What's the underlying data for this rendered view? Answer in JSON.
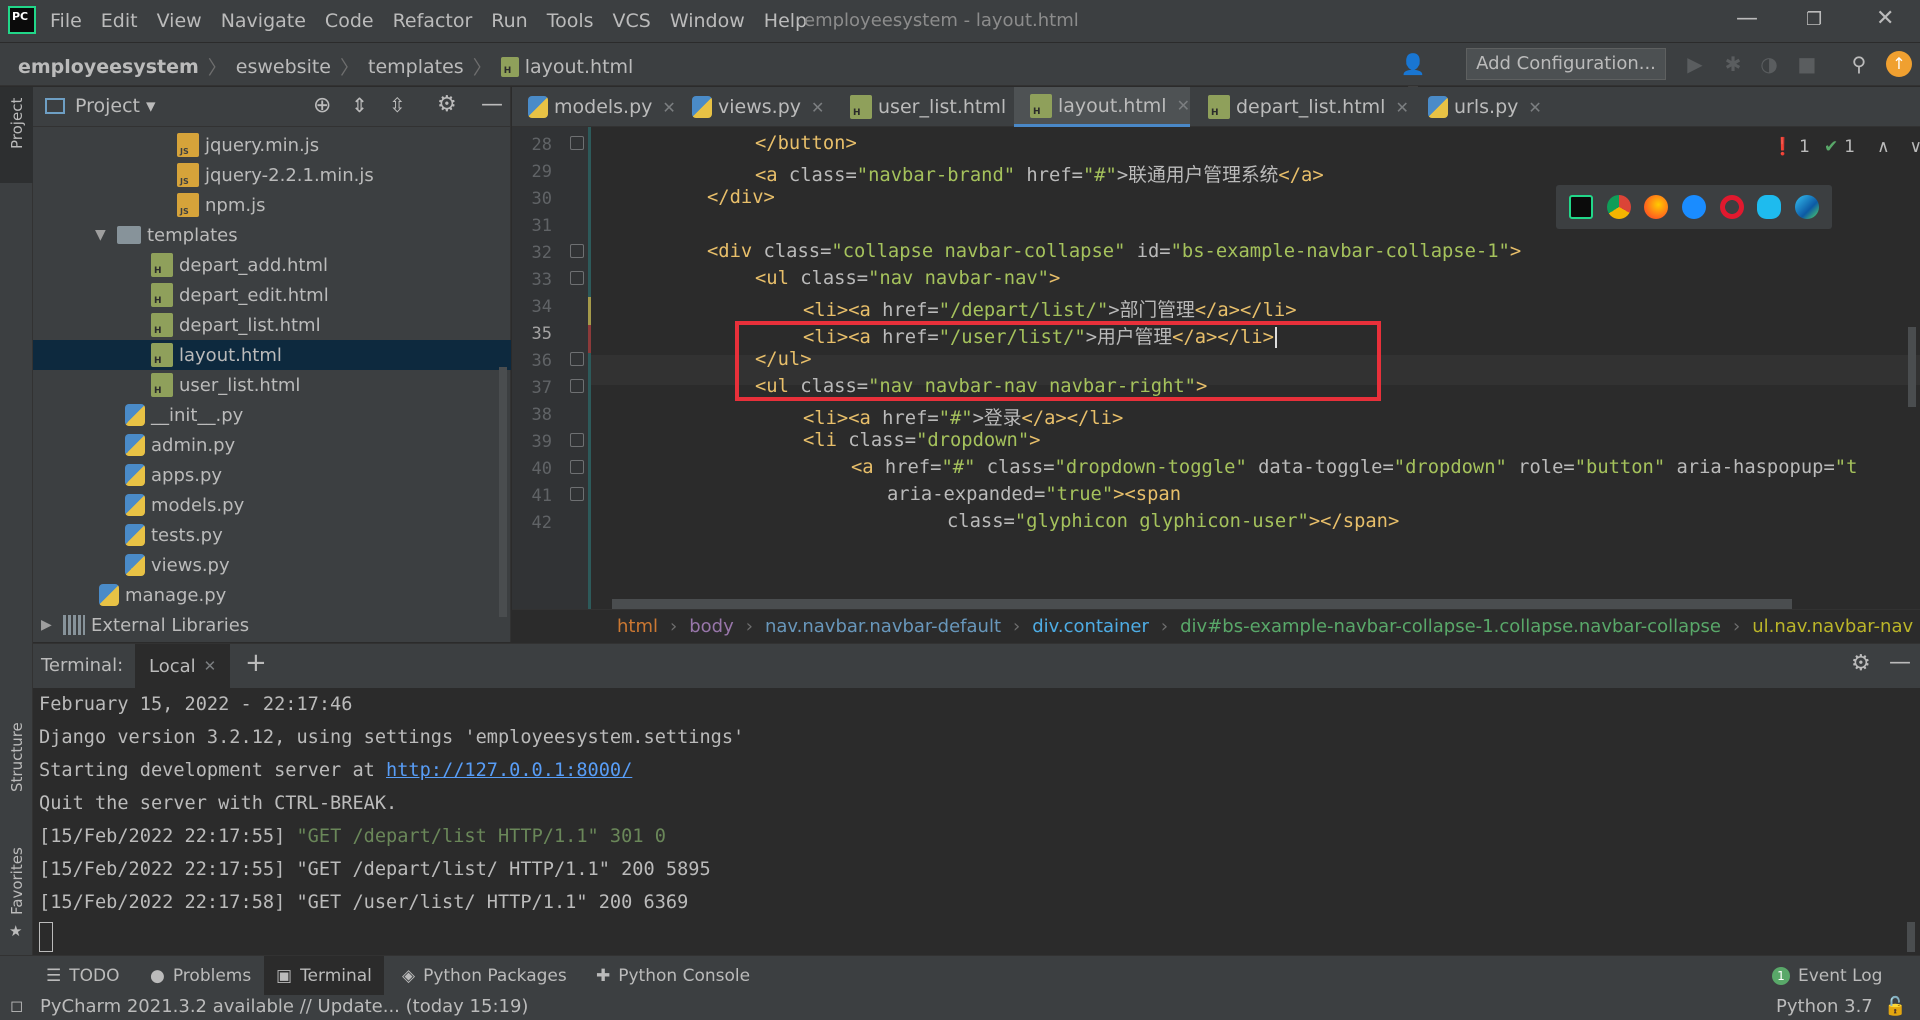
{
  "app": {
    "title": "employeesystem - layout.html",
    "logo": "PC",
    "menu": [
      "File",
      "Edit",
      "View",
      "Navigate",
      "Code",
      "Refactor",
      "Run",
      "Tools",
      "VCS",
      "Window",
      "Help"
    ]
  },
  "breadcrumb": {
    "project": "employeesystem",
    "items": [
      "eswebsite",
      "templates",
      "layout.html"
    ]
  },
  "toolbar": {
    "add_config": "Add Configuration..."
  },
  "side_labels": {
    "project": "Project",
    "structure": "Structure",
    "favorites": "Favorites"
  },
  "project_panel": {
    "title": "Project",
    "tree": [
      {
        "label": "jquery.min.js",
        "icon": "js-file-icon"
      },
      {
        "label": "jquery-2.2.1.min.js",
        "icon": "js-file-icon"
      },
      {
        "label": "npm.js",
        "icon": "js-file-icon"
      },
      {
        "label": "templates",
        "icon": "folder-icon"
      },
      {
        "label": "depart_add.html",
        "icon": "html-file-icon"
      },
      {
        "label": "depart_edit.html",
        "icon": "html-file-icon"
      },
      {
        "label": "depart_list.html",
        "icon": "html-file-icon"
      },
      {
        "label": "layout.html",
        "icon": "html-file-icon"
      },
      {
        "label": "user_list.html",
        "icon": "html-file-icon"
      },
      {
        "label": "__init__.py",
        "icon": "python-file-icon"
      },
      {
        "label": "admin.py",
        "icon": "python-file-icon"
      },
      {
        "label": "apps.py",
        "icon": "python-file-icon"
      },
      {
        "label": "models.py",
        "icon": "python-file-icon"
      },
      {
        "label": "tests.py",
        "icon": "python-file-icon"
      },
      {
        "label": "views.py",
        "icon": "python-file-icon"
      },
      {
        "label": "manage.py",
        "icon": "python-file-icon"
      },
      {
        "label": "External Libraries",
        "icon": "library-icon"
      }
    ]
  },
  "tabs": [
    "models.py",
    "views.py",
    "user_list.html",
    "layout.html",
    "depart_list.html",
    "urls.py"
  ],
  "editor": {
    "line_numbers": [
      "28",
      "29",
      "30",
      "31",
      "32",
      "33",
      "34",
      "35",
      "36",
      "37",
      "38",
      "39",
      "40",
      "41",
      "42"
    ],
    "lines": [
      [
        "</button>"
      ],
      [
        "<a",
        " class=",
        "\"navbar-brand\"",
        " href=",
        "\"#\"",
        ">联通用户管理系统",
        "</a>"
      ],
      [
        "</div>"
      ],
      [
        ""
      ],
      [
        "<div",
        " class=",
        "\"collapse navbar-collapse\"",
        " id=",
        "\"bs-example-navbar-collapse-1\"",
        ">"
      ],
      [
        "<ul",
        " class=",
        "\"nav navbar-nav\"",
        ">"
      ],
      [
        "<li><a",
        " href=",
        "\"/depart/list/\"",
        ">部门管理",
        "</a></li>"
      ],
      [
        "<li><a",
        " href=",
        "\"/user/list/\"",
        ">用户管理",
        "</a></li>"
      ],
      [
        "</ul>"
      ],
      [
        "<ul",
        " class=",
        "\"nav navbar-nav navbar-right\"",
        ">"
      ],
      [
        "<li><a",
        " href=",
        "\"#\"",
        ">登录",
        "</a></li>"
      ],
      [
        "<li",
        " class=",
        "\"dropdown\"",
        ">"
      ],
      [
        "<a",
        " href=",
        "\"#\"",
        " class=",
        "\"dropdown-toggle\"",
        " data-toggle=",
        "\"dropdown\"",
        " role=",
        "\"button\"",
        " aria-haspopup=",
        "\"t"
      ],
      [
        "aria-expanded=",
        "\"true\"",
        "><span"
      ],
      [
        "class=",
        "\"glyphicon glyphicon-user\"",
        "></span>"
      ]
    ],
    "inspections": {
      "errors": "1",
      "warnings": "1"
    },
    "structure_path": [
      "html",
      "body",
      "nav.navbar.navbar-default",
      "div.container",
      "div#bs-example-navbar-collapse-1.collapse.navbar-collapse",
      "ul.nav.navbar-nav"
    ]
  },
  "terminal": {
    "label": "Terminal:",
    "tab": "Local",
    "lines": [
      {
        "text": "February 15, 2022 - 22:17:46"
      },
      {
        "text": "Django version 3.2.12, using settings 'employeesystem.settings'"
      },
      {
        "prefix": "Starting development server at ",
        "link": "http://127.0.0.1:8000/"
      },
      {
        "text": "Quit the server with CTRL-BREAK."
      },
      {
        "prefix": "[15/Feb/2022 22:17:55] ",
        "green": "\"GET /depart/list HTTP/1.1\" 301 0"
      },
      {
        "text": "[15/Feb/2022 22:17:55] \"GET /depart/list/ HTTP/1.1\" 200 5895"
      },
      {
        "text": "[15/Feb/2022 22:17:58] \"GET /user/list/ HTTP/1.1\" 200 6369"
      }
    ]
  },
  "bottom_tabs": [
    "TODO",
    "Problems",
    "Terminal",
    "Python Packages",
    "Python Console"
  ],
  "event_log": "Event Log",
  "status": {
    "message": "PyCharm 2021.3.2 available // Update... (today 15:19)",
    "interpreter": "Python 3.7"
  },
  "colors": {
    "accent": "#4a88c7",
    "highlight_box": "#e8303a",
    "tag": "#e8bf6a",
    "string": "#a5c25c"
  }
}
